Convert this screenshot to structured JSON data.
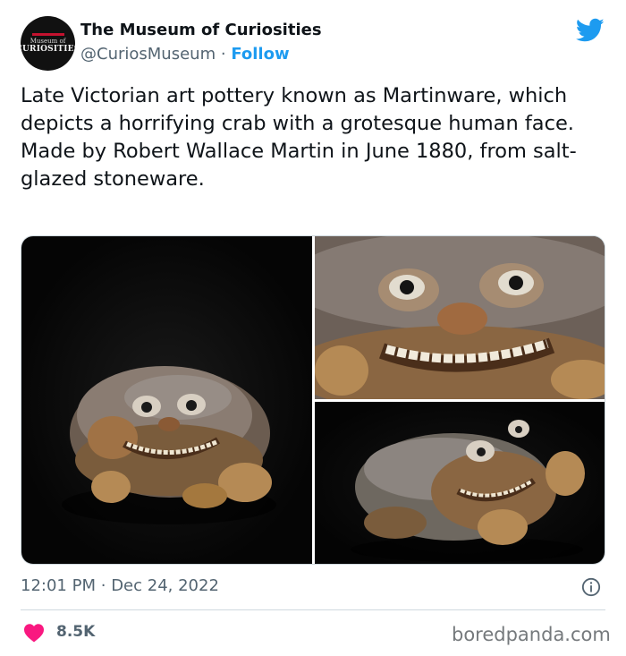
{
  "account": {
    "name": "The Museum of Curiosities",
    "handle": "@CuriosMuseum",
    "separator": "·",
    "follow_label": "Follow",
    "avatar_small": "Museum of",
    "avatar_big": "CURIOSITIES"
  },
  "tweet": {
    "text": "Late Victorian art pottery known as Martinware, which depicts a horrifying crab with a grotesque human face. Made by Robert Wallace Martin in June 1880, from salt-glazed stoneware.",
    "time": "12:01 PM",
    "date_separator": "·",
    "date": "Dec 24, 2022"
  },
  "engagement": {
    "likes": "8.5K"
  },
  "watermark": "boredpanda.com",
  "colors": {
    "accent": "#1d9bf0",
    "heart": "#f91880",
    "muted": "#536471"
  },
  "icons": {
    "bird": "twitter-bird-icon",
    "info": "info-icon",
    "heart": "heart-icon"
  }
}
